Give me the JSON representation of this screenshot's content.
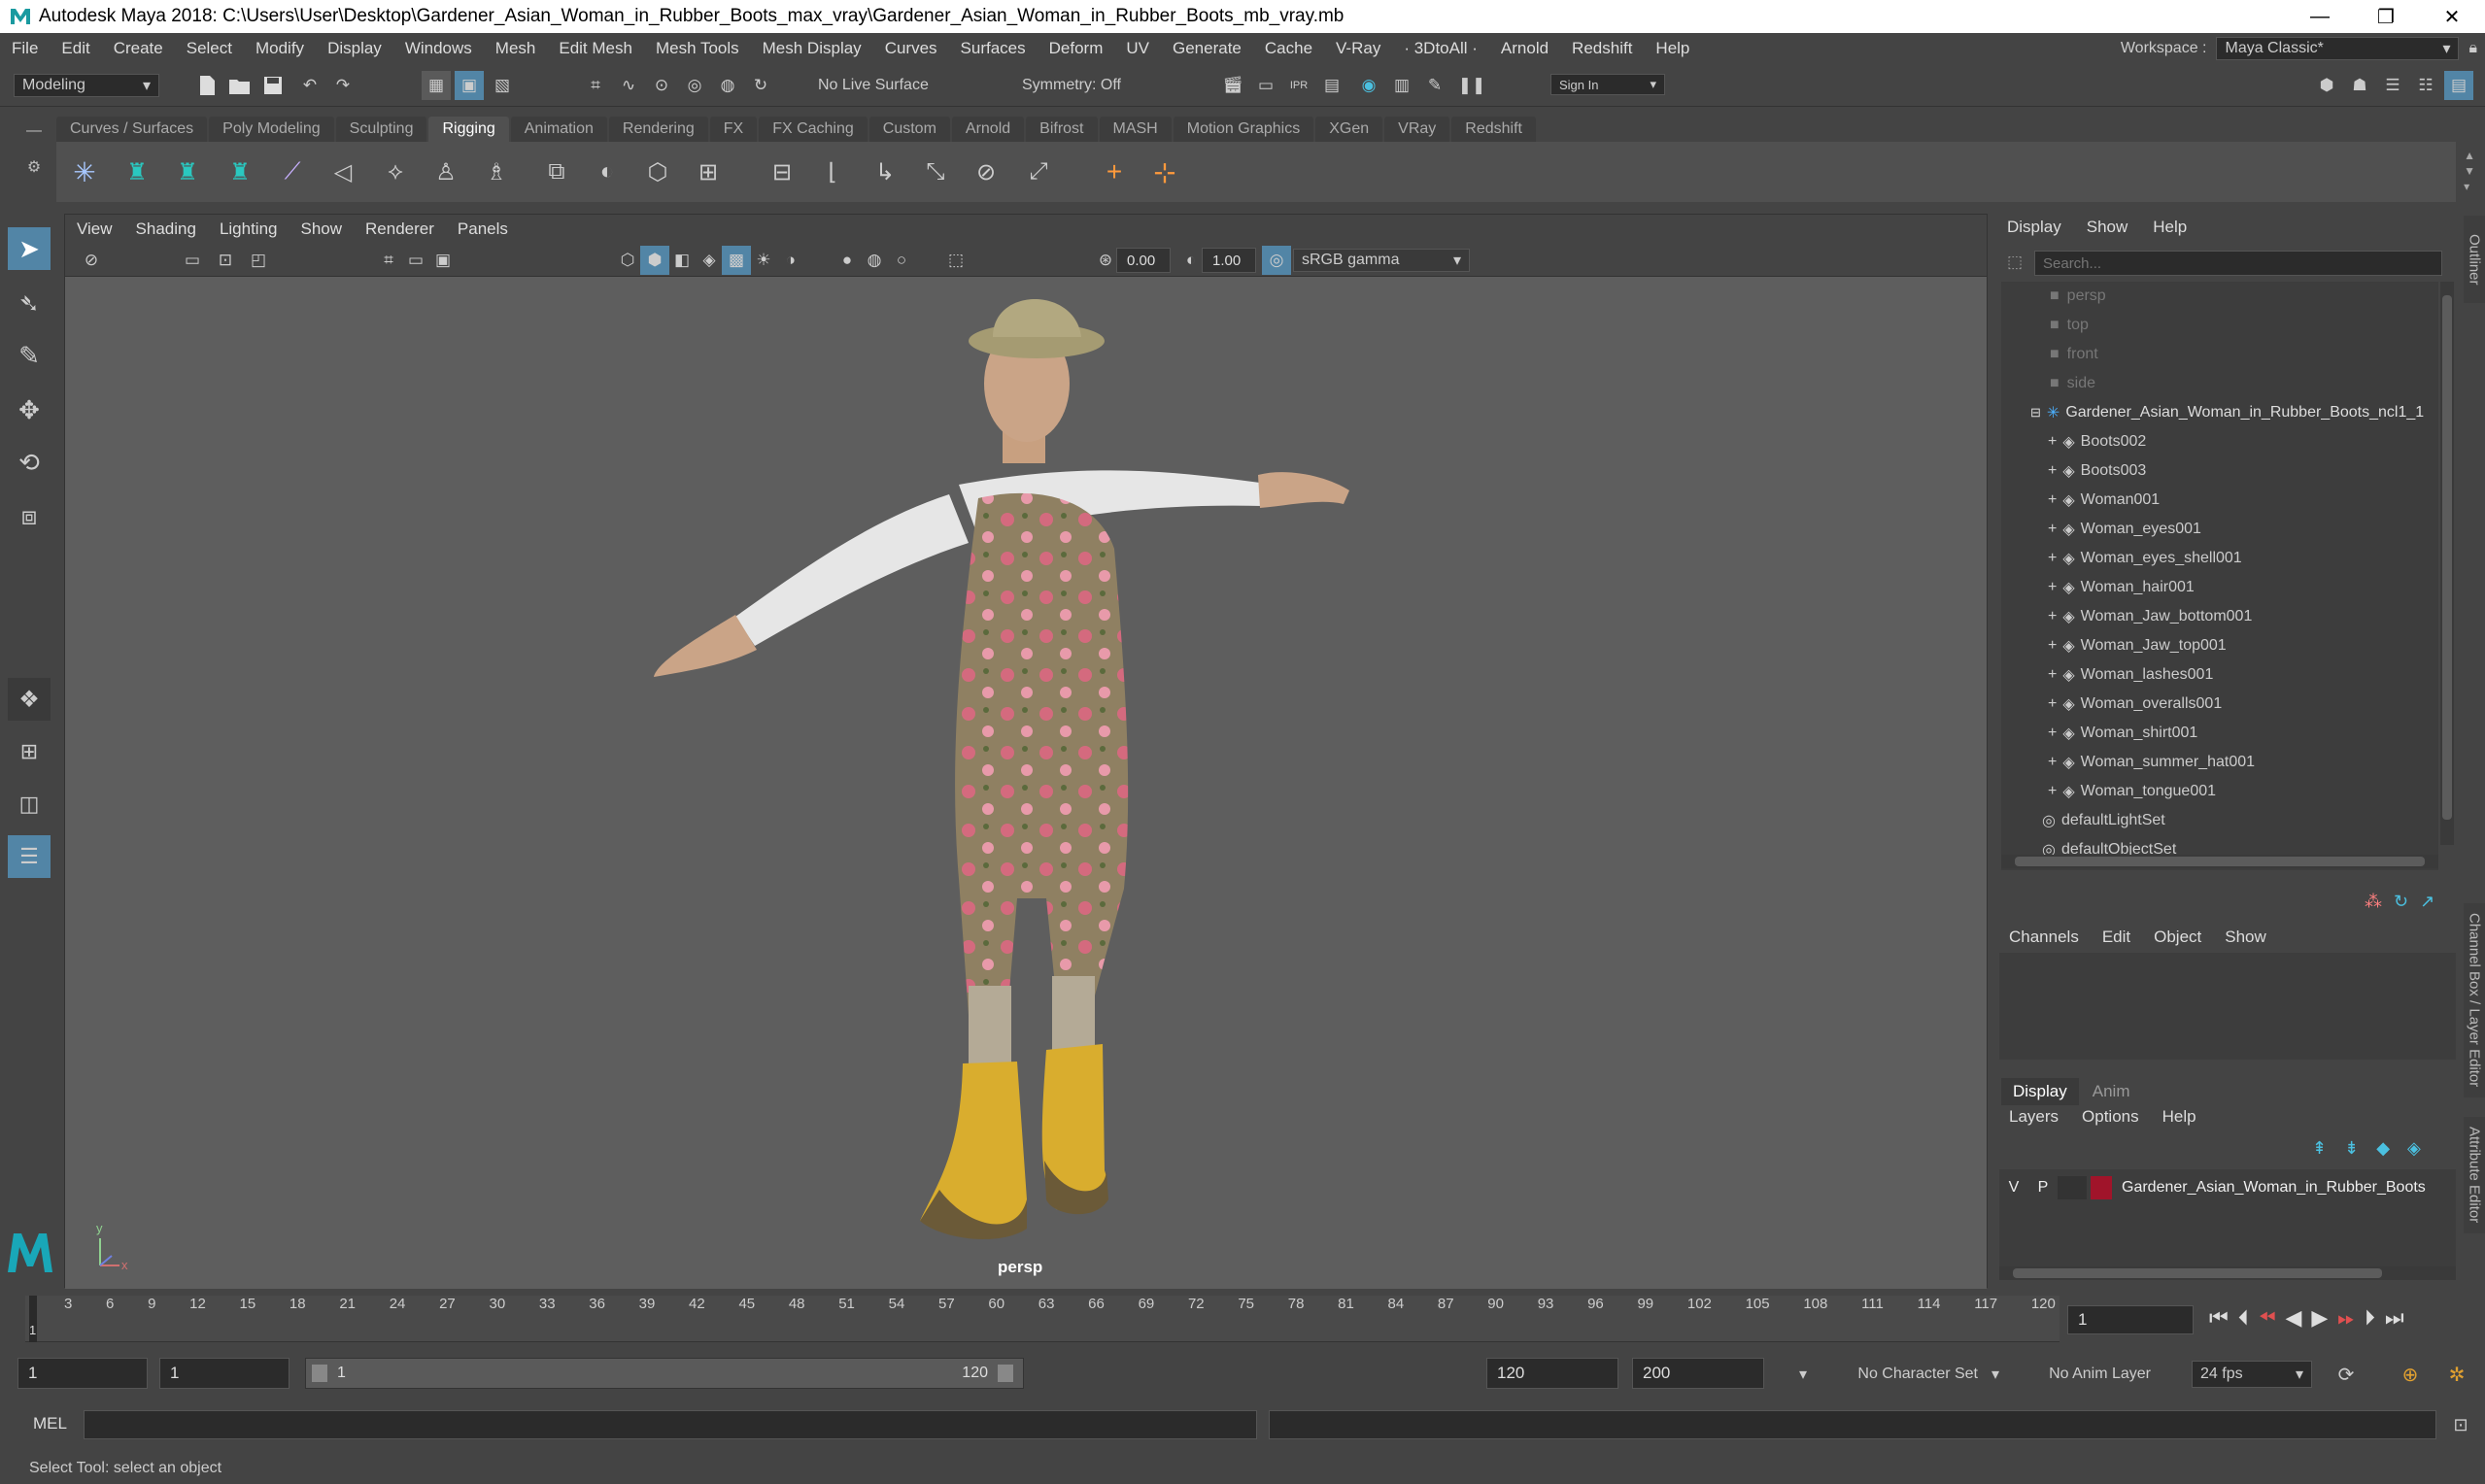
{
  "window": {
    "title": "Autodesk Maya 2018: C:\\Users\\User\\Desktop\\Gardener_Asian_Woman_in_Rubber_Boots_max_vray\\Gardener_Asian_Woman_in_Rubber_Boots_mb_vray.mb",
    "minimize": "—",
    "maximize": "❐",
    "close": "✕"
  },
  "menus": [
    "File",
    "Edit",
    "Create",
    "Select",
    "Modify",
    "Display",
    "Windows",
    "Mesh",
    "Edit Mesh",
    "Mesh Tools",
    "Mesh Display",
    "Curves",
    "Surfaces",
    "Deform",
    "UV",
    "Generate",
    "Cache",
    "V-Ray",
    "· 3DtoAll ·",
    "Arnold",
    "Redshift",
    "Help"
  ],
  "workspace": {
    "label": "Workspace :",
    "value": "Maya Classic*"
  },
  "status": {
    "mode": "Modeling",
    "live_surface": "No Live Surface",
    "symmetry": "Symmetry: Off",
    "sign_in": "Sign In"
  },
  "shelf_tabs": [
    "Curves / Surfaces",
    "Poly Modeling",
    "Sculpting",
    "Rigging",
    "Animation",
    "Rendering",
    "FX",
    "FX Caching",
    "Custom",
    "Arnold",
    "Bifrost",
    "MASH",
    "Motion Graphics",
    "XGen",
    "VRay",
    "Redshift"
  ],
  "shelf_active": "Rigging",
  "viewport": {
    "menu": [
      "View",
      "Shading",
      "Lighting",
      "Show",
      "Renderer",
      "Panels"
    ],
    "exposure": "0.00",
    "gamma": "1.00",
    "color_space": "sRGB gamma",
    "camera_label": "persp",
    "axis_y": "y",
    "axis_x": "x"
  },
  "outliner": {
    "menu": [
      "Display",
      "Show",
      "Help"
    ],
    "search_placeholder": "Search...",
    "cameras": [
      "persp",
      "top",
      "front",
      "side"
    ],
    "group": "Gardener_Asian_Woman_in_Rubber_Boots_ncl1_1",
    "children": [
      "Boots002",
      "Boots003",
      "Woman001",
      "Woman_eyes001",
      "Woman_eyes_shell001",
      "Woman_hair001",
      "Woman_Jaw_bottom001",
      "Woman_Jaw_top001",
      "Woman_lashes001",
      "Woman_overalls001",
      "Woman_shirt001",
      "Woman_summer_hat001",
      "Woman_tongue001"
    ],
    "sets": [
      "defaultLightSet",
      "defaultObjectSet"
    ],
    "side_tab": "Outliner"
  },
  "channel_box": {
    "menu": [
      "Channels",
      "Edit",
      "Object",
      "Show"
    ],
    "side_tab": "Channel Box / Layer Editor",
    "side_tab2": "Attribute Editor"
  },
  "layer_editor": {
    "tabs": [
      "Display",
      "Anim"
    ],
    "menu": [
      "Layers",
      "Options",
      "Help"
    ],
    "layer": {
      "v": "V",
      "p": "P",
      "color": "#a0142a",
      "name": "Gardener_Asian_Woman_in_Rubber_Boots"
    }
  },
  "timeline": {
    "ticks": [
      "3",
      "6",
      "9",
      "12",
      "15",
      "18",
      "21",
      "24",
      "27",
      "30",
      "33",
      "36",
      "39",
      "42",
      "45",
      "48",
      "51",
      "54",
      "57",
      "60",
      "63",
      "66",
      "69",
      "72",
      "75",
      "78",
      "81",
      "84",
      "87",
      "90",
      "93",
      "96",
      "99",
      "102",
      "105",
      "108",
      "111",
      "114",
      "117",
      "120"
    ],
    "current_frame_marker": "1",
    "current_frame": "1"
  },
  "range": {
    "start": "1",
    "anim_start": "1",
    "slider_start": "1",
    "slider_end": "120",
    "end": "120",
    "anim_end": "200",
    "character_set": "No Character Set",
    "anim_layer": "No Anim Layer",
    "fps": "24 fps"
  },
  "command": {
    "lang": "MEL"
  },
  "help_line": "Select Tool: select an object"
}
